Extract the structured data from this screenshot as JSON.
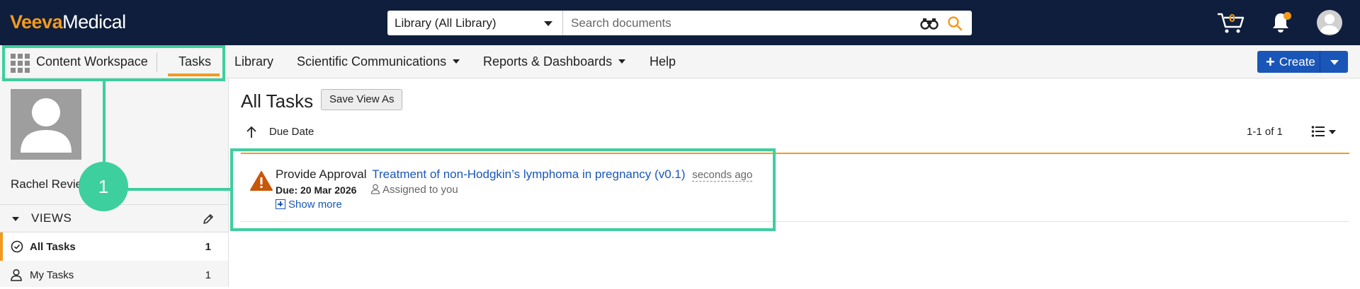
{
  "topbar": {
    "logo_brand": "Veeva",
    "logo_product": "Medical",
    "scope_value": "Library (All Library)",
    "search_placeholder": "Search documents",
    "cart_count": "0"
  },
  "nav": {
    "items": [
      {
        "label": "Content Workspace"
      },
      {
        "label": "Tasks"
      },
      {
        "label": "Library"
      },
      {
        "label": "Scientific Communications"
      },
      {
        "label": "Reports & Dashboards"
      },
      {
        "label": "Help"
      }
    ],
    "create_label": "Create"
  },
  "sidebar": {
    "user_name": "Rachel Review",
    "views_label": "VIEWS",
    "items": [
      {
        "label": "All Tasks",
        "count": "1"
      },
      {
        "label": "My Tasks",
        "count": "1"
      }
    ]
  },
  "main": {
    "title": "All Tasks",
    "save_view_label": "Save View As",
    "sort_label": "Due Date",
    "pager": "1-1 of 1",
    "task": {
      "action": "Provide Approval",
      "document": "Treatment of non-Hodgkin’s lymphoma in pregnancy (v0.1)",
      "time_ago": "seconds ago",
      "due": "Due: 20 Mar 2026",
      "assigned": "Assigned to you",
      "show_more": "Show more"
    }
  },
  "annotation": {
    "step_number": "1"
  },
  "colors": {
    "topbar_bg": "#0f1e3c",
    "brand_orange": "#f39a1e",
    "link_blue": "#1a56b8",
    "highlight_green": "#3dcf9e",
    "warning_orange": "#c8570a"
  },
  "icons": [
    "apps-grid-icon",
    "binoculars-icon",
    "search-icon",
    "cart-icon",
    "bell-icon",
    "user-avatar-icon",
    "pencil-icon",
    "check-circle-icon",
    "person-icon",
    "arrow-up-icon",
    "list-view-icon",
    "warning-icon",
    "plus-square-icon"
  ]
}
